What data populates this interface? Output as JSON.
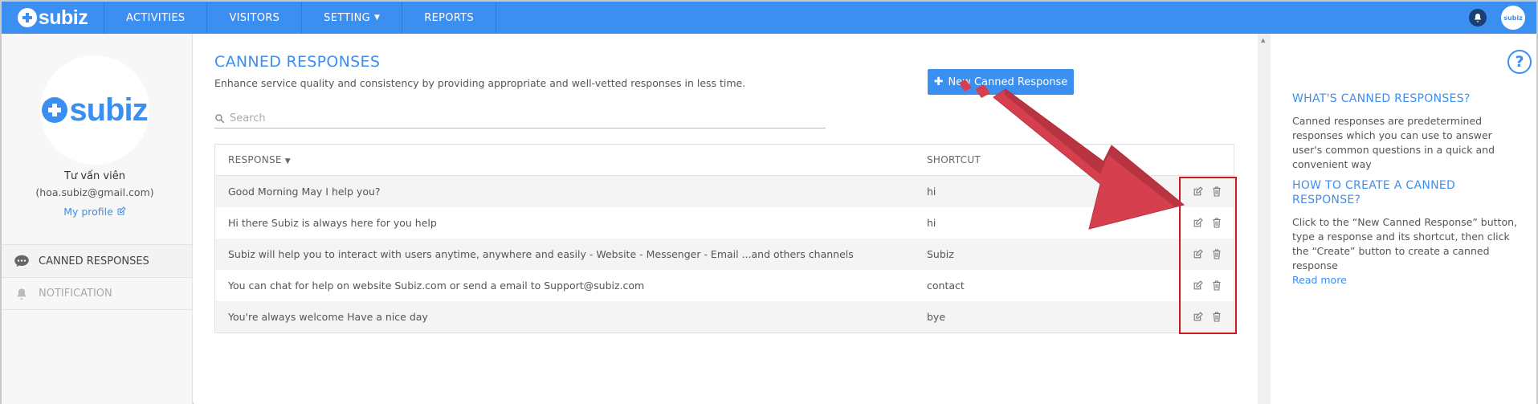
{
  "brand": {
    "name": "subiz"
  },
  "nav": {
    "items": [
      {
        "label": "ACTIVITIES"
      },
      {
        "label": "VISITORS"
      },
      {
        "label": "SETTING"
      },
      {
        "label": "REPORTS"
      }
    ],
    "avatar_text": "subiz"
  },
  "sidebar": {
    "name": "Tư vấn viên",
    "email": "(hoa.subiz@gmail.com)",
    "profile_link": "My profile",
    "menu": [
      {
        "label": "CANNED RESPONSES"
      },
      {
        "label": "NOTIFICATION"
      }
    ]
  },
  "main": {
    "title": "CANNED RESPONSES",
    "subtitle": "Enhance service quality and consistency by providing appropriate and well-vetted responses in less time.",
    "new_button": "New Canned Response",
    "search_placeholder": "Search",
    "columns": {
      "response": "RESPONSE",
      "shortcut": "SHORTCUT"
    },
    "rows": [
      {
        "response": "Good Morning May I help you?",
        "shortcut": "hi"
      },
      {
        "response": "Hi there Subiz is always here for you help",
        "shortcut": "hi"
      },
      {
        "response": "Subiz will help you to interact with users anytime, anywhere and easily - Website - Messenger - Email ...and others channels",
        "shortcut": "Subiz"
      },
      {
        "response": "You can chat for help on website Subiz.com or send a email to Support@subiz.com",
        "shortcut": "contact"
      },
      {
        "response": "You're always welcome Have a nice day",
        "shortcut": "bye"
      }
    ]
  },
  "help": {
    "heading1": "WHAT'S CANNED RESPONSES?",
    "text1": "Canned responses are predetermined responses which you can use to answer user's common questions in a quick and convenient way",
    "heading2": "HOW TO CREATE A CANNED RESPONSE?",
    "text2": "Click to the “New Canned Response” button, type a response and its shortcut, then click the “Create” button to create a canned response",
    "read_more": "Read more"
  },
  "colors": {
    "primary": "#3b8ff0",
    "highlight": "#d0181f",
    "arrow": "#d6404e"
  }
}
